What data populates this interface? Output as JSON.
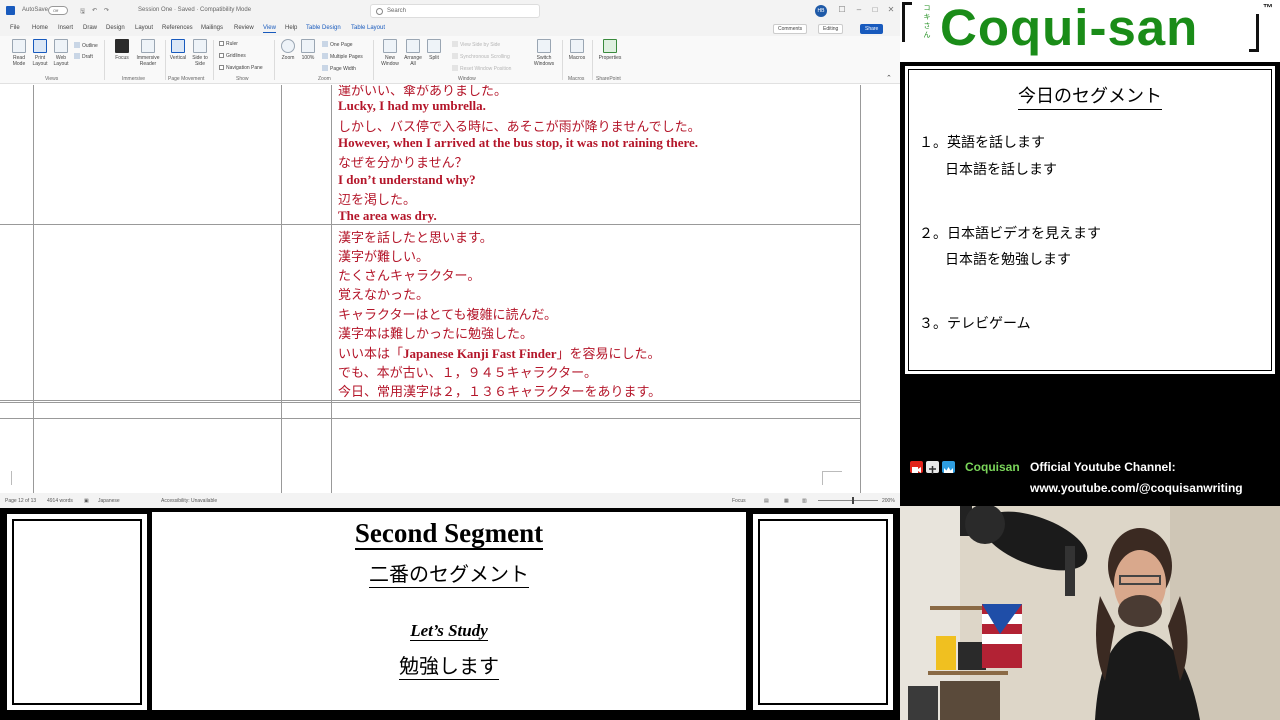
{
  "word": {
    "titlebar": {
      "autosave": "AutoSave",
      "autosave_state": "Off",
      "doc_title": "Session One · Saved · Compatibility Mode",
      "search_placeholder": "Search",
      "user_initials": "HB"
    },
    "menu": [
      "File",
      "Home",
      "Insert",
      "Draw",
      "Design",
      "Layout",
      "References",
      "Mailings",
      "Review",
      "View",
      "Help",
      "Table Design",
      "Table Layout"
    ],
    "menu_active": "View",
    "comments_label": "Comments",
    "editing_label": "Editing",
    "share_label": "Share",
    "ribbon": {
      "read_mode": "Read Mode",
      "print_layout": "Print Layout",
      "web_layout": "Web Layout",
      "outline": "Outline",
      "draft": "Draft",
      "focus": "Focus",
      "immersive_reader": "Immersive Reader",
      "vertical": "Vertical",
      "side_to_side": "Side to Side",
      "ruler": "Ruler",
      "gridlines": "Gridlines",
      "navigation_pane": "Navigation Pane",
      "zoom": "Zoom",
      "zoom_100": "100%",
      "one_page": "One Page",
      "multiple_pages": "Multiple Pages",
      "page_width": "Page Width",
      "new_window": "New Window",
      "arrange_all": "Arrange All",
      "split": "Split",
      "view_side_by_side": "View Side by Side",
      "sync_scrolling": "Synchronous Scrolling",
      "reset_window_position": "Reset Window Position",
      "switch_windows": "Switch Windows",
      "macros": "Macros",
      "properties": "Properties",
      "groups": [
        "Views",
        "Immersive",
        "Page Movement",
        "Show",
        "Zoom",
        "Window",
        "Macros",
        "SharePoint"
      ]
    },
    "doc_lines": [
      {
        "type": "jp",
        "text": "運がいい、傘がありました。"
      },
      {
        "type": "en",
        "text": "Lucky, I had my umbrella."
      },
      {
        "type": "jp",
        "text": "しかし、バス停で入る時に、あそこが雨が降りませんでした。"
      },
      {
        "type": "en",
        "text": "However, when I arrived at the bus stop, it was not raining there."
      },
      {
        "type": "jp",
        "text": "なぜを分かりません？"
      },
      {
        "type": "en",
        "text": "I don’t understand why?"
      },
      {
        "type": "jp",
        "text": "辺を渇した。"
      },
      {
        "type": "en",
        "text": "The area was dry."
      }
    ],
    "doc_lines_2": [
      "漢字を話したと思います。",
      "漢字が難しい。",
      "たくさんキャラクター。",
      "覚えなかった。",
      "キャラクターはとても複雑に読んだ。",
      "漢字本は難しかったに勉強した。"
    ],
    "kanji_book_line": {
      "pre": "いい本は「",
      "title": "Japanese Kanji Fast Finder",
      "post": "」を容易にした。"
    },
    "doc_lines_3": [
      "でも、本が古い、１，９４５キャラクター。",
      "今日、常用漢字は２，１３６キャラクターをあります。"
    ],
    "status": {
      "page": "Page 12 of 13",
      "words": "4914 words",
      "language": "Japanese",
      "accessibility": "Accessibility: Unavailable",
      "focus": "Focus",
      "zoom": "200%"
    }
  },
  "logo": {
    "text": "Coqui-san",
    "furigana": "コキさん",
    "tm": "™"
  },
  "today": {
    "title": "今日のセグメント",
    "items": [
      {
        "num": "１。",
        "main": "英語を話します",
        "sub": "日本語を話します"
      },
      {
        "num": "２。",
        "main": "日本語ビデオを見えます",
        "sub": "日本語を勉強します"
      },
      {
        "num": "３。",
        "main": "テレビゲーム",
        "sub": ""
      }
    ]
  },
  "channel": {
    "name": "Coquisan",
    "label": "Official Youtube Channel:",
    "url": "www.youtube.com/@coquisanwriting"
  },
  "segment": {
    "title_en": "Second Segment",
    "title_jp": "二番のセグメント",
    "sub_en": "Let’s Study",
    "sub_jp": "勉強します"
  },
  "colors": {
    "brand_green": "#1a8c18",
    "doc_red": "#b4162a",
    "word_blue": "#185abd"
  }
}
